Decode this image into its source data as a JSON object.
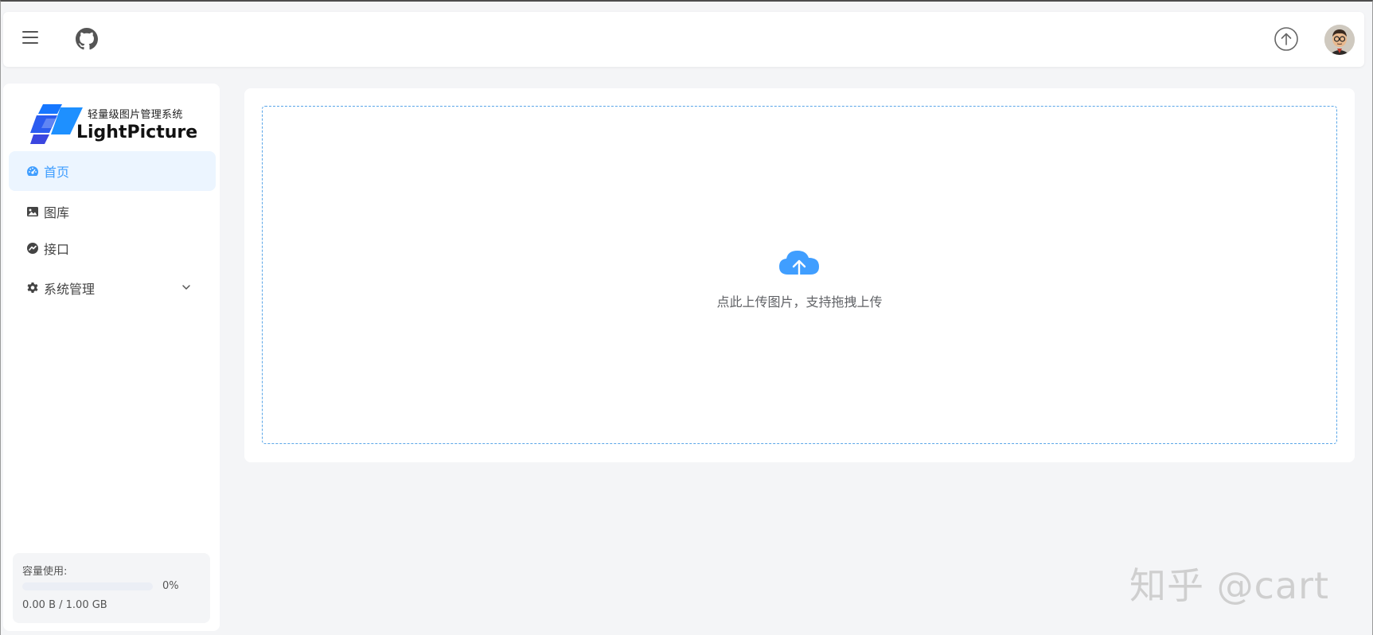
{
  "header": {
    "menu_icon": "hamburger-icon",
    "github_icon": "github-icon",
    "upload_icon": "upload-circle-icon",
    "avatar": "user-avatar"
  },
  "logo": {
    "subtitle": "轻量级图片管理系统",
    "title": "LightPicture"
  },
  "sidebar": {
    "items": [
      {
        "label": "首页",
        "icon": "dashboard-icon",
        "active": true
      },
      {
        "label": "图库",
        "icon": "image-icon",
        "active": false
      },
      {
        "label": "接口",
        "icon": "api-icon",
        "active": false
      },
      {
        "label": "系统管理",
        "icon": "gear-icon",
        "active": false,
        "expandable": true
      }
    ]
  },
  "capacity": {
    "label": "容量使用:",
    "percent_text": "0%",
    "percent_value": 0,
    "size_text": "0.00 B / 1.00 GB"
  },
  "upload": {
    "icon": "cloud-upload-icon",
    "text": "点此上传图片，支持拖拽上传"
  },
  "watermark": "知乎 @cart",
  "colors": {
    "accent": "#409eff",
    "active_bg": "#ecf5ff",
    "page_bg": "#f4f5f7"
  }
}
